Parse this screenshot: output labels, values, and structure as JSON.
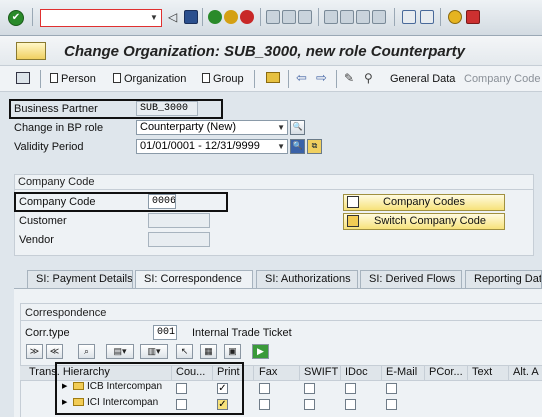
{
  "window": {
    "title": "Change Organization: SUB_3000, new role Counterparty"
  },
  "toolbar": {
    "command_field": "",
    "icons": [
      "enter-icon",
      "save-icon",
      "back-icon",
      "exit-icon",
      "cancel-icon",
      "print-icon",
      "find-icon",
      "find-next-icon",
      "first-page-icon",
      "prev-page-icon",
      "next-page-icon",
      "last-page-icon",
      "new-session-icon",
      "shortcut-icon",
      "help-icon",
      "customize-layout-icon"
    ]
  },
  "appbar": {
    "buttons": [
      "Person",
      "Organization",
      "Group",
      "General Data",
      "Company Code"
    ]
  },
  "header": {
    "business_partner": {
      "label": "Business Partner",
      "value": "SUB_3000"
    },
    "bp_role": {
      "label": "Change in BP role",
      "value": "Counterparty (New)"
    },
    "validity": {
      "label": "Validity Period",
      "value": "01/01/0001 - 12/31/9999"
    }
  },
  "company_code_section": {
    "title": "Company Code",
    "company_code": {
      "label": "Company Code",
      "value": "0006"
    },
    "customer": {
      "label": "Customer",
      "value": ""
    },
    "vendor": {
      "label": "Vendor",
      "value": ""
    },
    "company_codes_button": "Company Codes",
    "switch_button": "Switch Company Code"
  },
  "tabs": [
    "SI: Payment Details",
    "SI: Correspondence",
    "SI: Authorizations",
    "SI: Derived Flows",
    "Reporting Dat"
  ],
  "active_tab": "SI: Correspondence",
  "correspondence": {
    "title": "Correspondence",
    "corr_type": {
      "label": "Corr.type",
      "value": "001",
      "description": "Internal Trade Ticket"
    },
    "columns": [
      "Trans. Hierarchy",
      "Cou...",
      "Print",
      "Fax",
      "SWIFT",
      "IDoc",
      "E-Mail",
      "PCor...",
      "Text",
      "Alt. A"
    ],
    "rows": [
      {
        "code": "ICB",
        "name": "Intercompan",
        "country": false,
        "print": true,
        "fax": false,
        "swift": false,
        "idoc": false,
        "email": false
      },
      {
        "code": "ICI",
        "name": "Intercompan",
        "country": false,
        "print": true,
        "fax": false,
        "swift": false,
        "idoc": false,
        "email": false
      }
    ]
  },
  "colors": {
    "accent": "#f7e27a",
    "background": "#dfe6ec",
    "highlight_box": "#111111"
  }
}
